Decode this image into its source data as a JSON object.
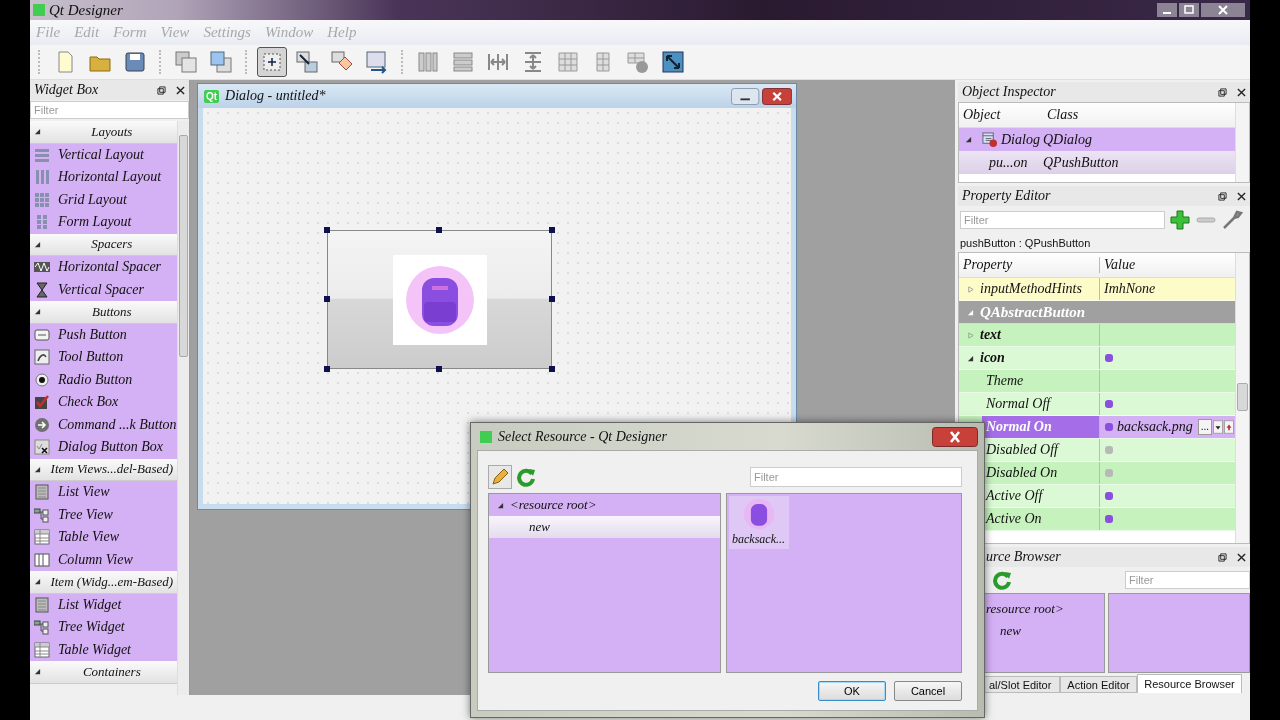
{
  "app": {
    "title": "Qt Designer"
  },
  "menu": [
    {
      "label": "File",
      "disabled": true
    },
    {
      "label": "Edit",
      "disabled": true
    },
    {
      "label": "Form",
      "disabled": true
    },
    {
      "label": "View",
      "disabled": true
    },
    {
      "label": "Settings",
      "disabled": true
    },
    {
      "label": "Window",
      "disabled": true
    },
    {
      "label": "Help",
      "disabled": true
    }
  ],
  "toolbar_groups": [
    {
      "tools": [
        {
          "kind": "new",
          "selected": false
        },
        {
          "kind": "open",
          "selected": false
        },
        {
          "kind": "save",
          "selected": false
        }
      ]
    },
    {
      "tools": [
        {
          "kind": "send_back",
          "selected": false
        },
        {
          "kind": "bring_front",
          "selected": false
        }
      ]
    },
    {
      "tools": [
        {
          "kind": "edit_widgets",
          "selected": true
        },
        {
          "kind": "edit_signals",
          "selected": false
        },
        {
          "kind": "edit_buddies",
          "selected": false
        },
        {
          "kind": "edit_tab_order",
          "selected": false
        }
      ]
    },
    {
      "tools": [
        {
          "kind": "layout_h",
          "selected": false
        },
        {
          "kind": "layout_v",
          "selected": false
        },
        {
          "kind": "splitter_h",
          "selected": false
        },
        {
          "kind": "splitter_v",
          "selected": false
        },
        {
          "kind": "layout_grid",
          "selected": false
        },
        {
          "kind": "layout_form",
          "selected": false
        },
        {
          "kind": "break_layout",
          "selected": false
        },
        {
          "kind": "adjust_size",
          "selected": false
        }
      ]
    }
  ],
  "widget_box": {
    "title": "Widget Box",
    "filter": {
      "placeholder": "Filter"
    },
    "categories": [
      {
        "label": "Layouts",
        "expanded": true,
        "items": [
          {
            "label": "Vertical Layout",
            "kind": "vertical_layout"
          },
          {
            "label": "Horizontal Layout",
            "kind": "horizontal_layout"
          },
          {
            "label": "Grid Layout",
            "kind": "grid_layout"
          },
          {
            "label": "Form Layout",
            "kind": "form_layout"
          }
        ]
      },
      {
        "label": "Spacers",
        "expanded": true,
        "items": [
          {
            "label": "Horizontal Spacer",
            "kind": "horizontal_spacer"
          },
          {
            "label": "Vertical Spacer",
            "kind": "vertical_spacer"
          }
        ]
      },
      {
        "label": "Buttons",
        "expanded": true,
        "items": [
          {
            "label": "Push Button",
            "kind": "push_button"
          },
          {
            "label": "Tool Button",
            "kind": "tool_button"
          },
          {
            "label": "Radio Button",
            "kind": "radio_button"
          },
          {
            "label": "Check Box",
            "kind": "check_box"
          },
          {
            "label": "Command ...k Button",
            "kind": "command_link"
          },
          {
            "label": "Dialog Button Box",
            "kind": "button_box"
          }
        ]
      },
      {
        "label": "Item Views...del-Based)",
        "expanded": true,
        "items": [
          {
            "label": "List View",
            "kind": "list"
          },
          {
            "label": "Tree View",
            "kind": "tree"
          },
          {
            "label": "Table View",
            "kind": "table"
          },
          {
            "label": "Column View",
            "kind": "column"
          }
        ]
      },
      {
        "label": "Item (Widg...em-Based)",
        "expanded": true,
        "items": [
          {
            "label": "List Widget",
            "kind": "list"
          },
          {
            "label": "Tree Widget",
            "kind": "tree"
          },
          {
            "label": "Table Widget",
            "kind": "table"
          }
        ]
      },
      {
        "label": "Containers",
        "expanded": true
      }
    ]
  },
  "form_window": {
    "icon_text": "Qt",
    "title": "Dialog - untitled*",
    "push_button": {
      "selected": true
    }
  },
  "object_inspector": {
    "title": "Object Inspector",
    "columns": [
      "Object",
      "Class"
    ],
    "rows": [
      {
        "object": "Dialog",
        "class": "QDialog",
        "expanded": true,
        "selected": false,
        "children": [
          {
            "object": "pu...on",
            "class": "QPushButton",
            "selected": true
          }
        ]
      }
    ]
  },
  "property_editor": {
    "title": "Property Editor",
    "filter": {
      "placeholder": "Filter"
    },
    "object_label": "pushButton : QPushButton",
    "columns": [
      "Property",
      "Value"
    ],
    "rows": [
      {
        "kind": "property",
        "name": "inputMethodHints",
        "value": "ImhNone",
        "expanded": false,
        "color": "#fdfbc8",
        "selected": false
      },
      {
        "kind": "section",
        "name": "QAbstractButton",
        "expanded": true,
        "color": "#a0a0a0",
        "children": [
          {
            "kind": "property",
            "name": "text",
            "bold": true,
            "expanded": false,
            "color": "#c6f2bd",
            "selected": false
          },
          {
            "kind": "property",
            "name": "icon",
            "bold": true,
            "expanded": true,
            "icon_disabled": false,
            "color": "#dcf9d5",
            "selected": false,
            "children": [
              {
                "kind": "property",
                "name": "Theme",
                "color": "#c6f2bd",
                "selected": false
              },
              {
                "kind": "property",
                "name": "Normal Off",
                "icon_disabled": false,
                "color": "#dcf9d5",
                "selected": false
              },
              {
                "kind": "property",
                "name": "Normal On",
                "icon_disabled": false,
                "value": "backsack.png",
                "browse_label": "...",
                "color": "#c6f2bd",
                "selected": true
              },
              {
                "kind": "property",
                "name": "Disabled Off",
                "icon_disabled": true,
                "color": "#dcf9d5",
                "selected": false
              },
              {
                "kind": "property",
                "name": "Disabled On",
                "icon_disabled": true,
                "color": "#c6f2bd",
                "selected": false
              },
              {
                "kind": "property",
                "name": "Active Off",
                "icon_disabled": false,
                "color": "#dcf9d5",
                "selected": false
              },
              {
                "kind": "property",
                "name": "Active On",
                "icon_disabled": false,
                "color": "#c6f2bd",
                "selected": false
              }
            ]
          }
        ]
      }
    ]
  },
  "resource_browser": {
    "title": "urce Browser",
    "filter": {
      "placeholder": "Filter"
    },
    "tree": [
      {
        "label": "resource root>",
        "selected": false,
        "children": [
          {
            "label": "new",
            "selected": false
          }
        ]
      }
    ]
  },
  "bottom_tabs": [
    {
      "label": "al/Slot Editor",
      "selected": false
    },
    {
      "label": "Action Editor",
      "selected": false
    },
    {
      "label": "Resource Browser",
      "selected": true
    }
  ],
  "select_resource_dialog": {
    "title": "Select Resource - Qt Designer",
    "filter": {
      "placeholder": "Filter"
    },
    "tree": [
      {
        "label": "<resource root>",
        "expanded": true,
        "selected": false,
        "children": [
          {
            "label": "new",
            "selected": true
          }
        ]
      }
    ],
    "files": [
      {
        "label": "backsack..."
      }
    ],
    "buttons": [
      {
        "label": "OK",
        "default": true
      },
      {
        "label": "Cancel",
        "default": false
      }
    ]
  }
}
